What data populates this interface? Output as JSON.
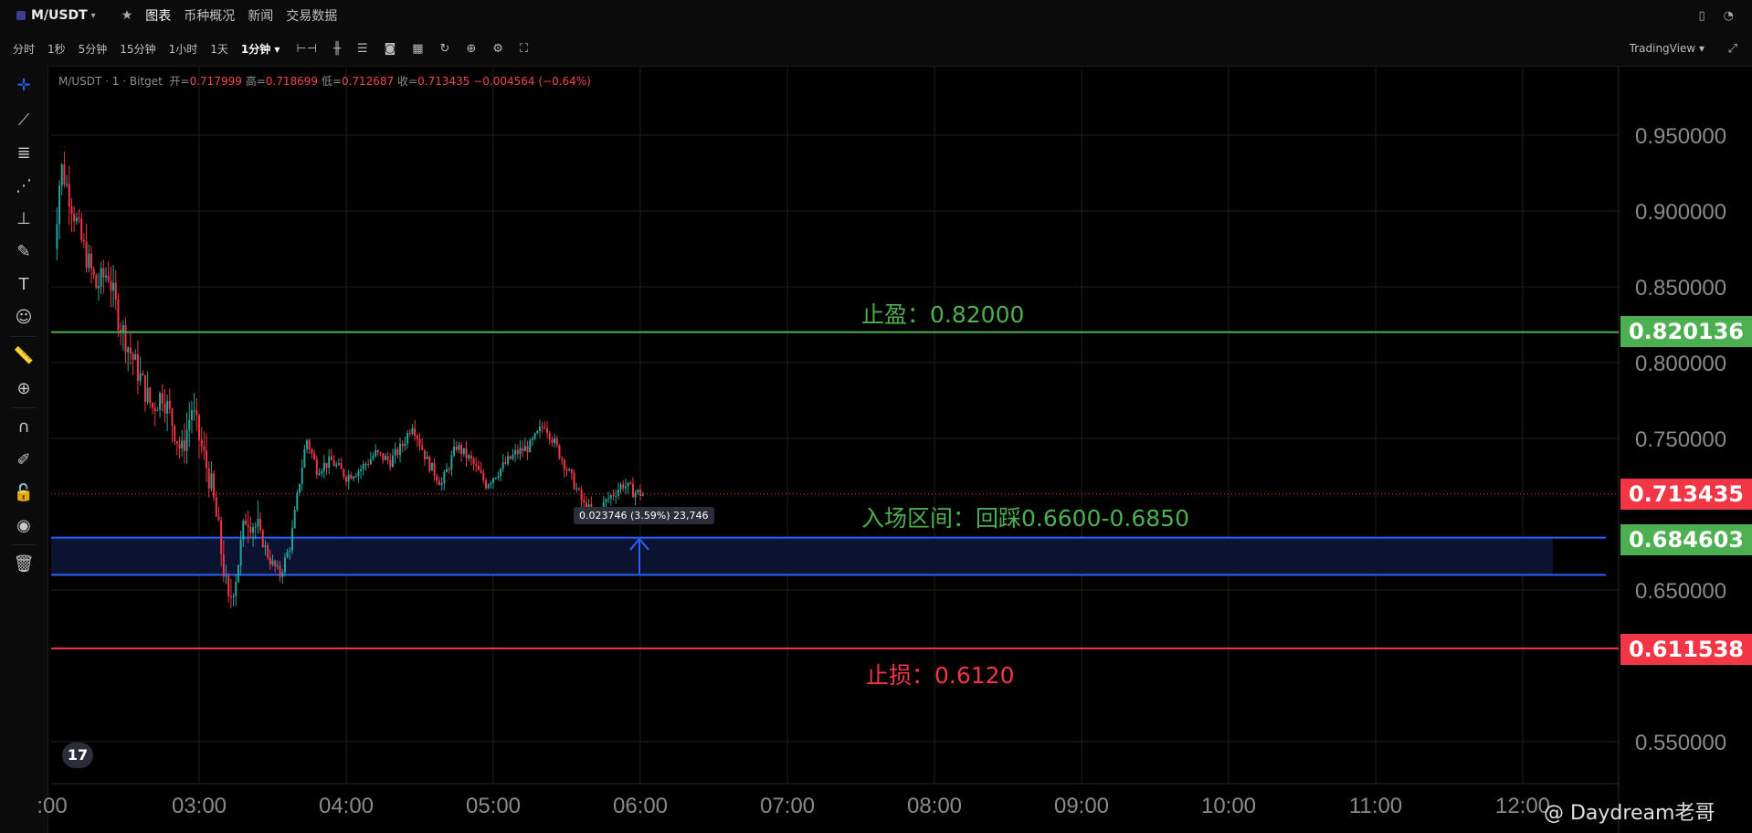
{
  "header": {
    "symbol": "M/USDT",
    "tabs": [
      "图表",
      "币种概况",
      "新闻",
      "交易数据"
    ]
  },
  "intervals": [
    "分时",
    "1秒",
    "5分钟",
    "15分钟",
    "1小时",
    "1天",
    "1分钟"
  ],
  "toolbar_right": "TradingView",
  "legend": {
    "title": "M/USDT · 1 · Bitget",
    "open_label": "开",
    "open": "0.717999",
    "high_label": "高",
    "high": "0.718699",
    "low_label": "低",
    "low": "0.712687",
    "close_label": "收",
    "close": "0.713435",
    "change": "−0.004564 (−0.64%)"
  },
  "price_axis": [
    "0.950000",
    "0.900000",
    "0.850000",
    "0.800000",
    "0.750000",
    "0.650000",
    "0.550000"
  ],
  "time_axis": [
    ":00",
    "03:00",
    "04:00",
    "05:00",
    "06:00",
    "07:00",
    "08:00",
    "09:00",
    "10:00",
    "11:00",
    "12:00"
  ],
  "annotations": {
    "take_profit": "止盈：0.82000",
    "entry": "入场区间：回踩0.6600-0.6850",
    "stop_loss": "止损：0.6120"
  },
  "price_labels": {
    "take_profit": "0.820136",
    "current": "0.713435",
    "entry": "0.684603",
    "stop_loss": "0.611538"
  },
  "tooltip": "0.023746 (3.59%) 23,746",
  "watermark": "@ Daydream老哥",
  "colors": {
    "up": "#26a69a",
    "down": "#f23645",
    "take_profit": "#4caf50",
    "entry_zone": "#2962ff",
    "stop_loss": "#f23645"
  },
  "chart_data": {
    "type": "candlestick",
    "ylim": [
      0.53,
      0.97
    ],
    "price_lines": [
      0.820136,
      0.713435,
      0.684603,
      0.611538
    ],
    "entry_zone": [
      0.66,
      0.6846
    ],
    "close_path": [
      [
        2.0,
        0.86
      ],
      [
        2.06,
        0.93
      ],
      [
        2.12,
        0.91
      ],
      [
        2.2,
        0.88
      ],
      [
        2.3,
        0.85
      ],
      [
        2.38,
        0.86
      ],
      [
        2.45,
        0.83
      ],
      [
        2.52,
        0.81
      ],
      [
        2.6,
        0.79
      ],
      [
        2.68,
        0.77
      ],
      [
        2.75,
        0.78
      ],
      [
        2.82,
        0.76
      ],
      [
        2.88,
        0.74
      ],
      [
        2.95,
        0.77
      ],
      [
        3.0,
        0.75
      ],
      [
        3.08,
        0.72
      ],
      [
        3.13,
        0.69
      ],
      [
        3.2,
        0.64
      ],
      [
        3.25,
        0.66
      ],
      [
        3.32,
        0.7
      ],
      [
        3.4,
        0.69
      ],
      [
        3.48,
        0.67
      ],
      [
        3.55,
        0.66
      ],
      [
        3.62,
        0.68
      ],
      [
        3.68,
        0.72
      ],
      [
        3.73,
        0.75
      ],
      [
        3.8,
        0.73
      ],
      [
        3.9,
        0.735
      ],
      [
        4.0,
        0.725
      ],
      [
        4.1,
        0.73
      ],
      [
        4.2,
        0.74
      ],
      [
        4.3,
        0.735
      ],
      [
        4.38,
        0.745
      ],
      [
        4.45,
        0.76
      ],
      [
        4.55,
        0.735
      ],
      [
        4.65,
        0.72
      ],
      [
        4.75,
        0.745
      ],
      [
        4.85,
        0.735
      ],
      [
        4.95,
        0.72
      ],
      [
        5.05,
        0.73
      ],
      [
        5.15,
        0.74
      ],
      [
        5.25,
        0.745
      ],
      [
        5.35,
        0.76
      ],
      [
        5.45,
        0.74
      ],
      [
        5.55,
        0.72
      ],
      [
        5.62,
        0.705
      ],
      [
        5.7,
        0.7
      ],
      [
        5.78,
        0.71
      ],
      [
        5.88,
        0.72
      ],
      [
        5.95,
        0.715
      ],
      [
        6.03,
        0.713
      ]
    ]
  }
}
